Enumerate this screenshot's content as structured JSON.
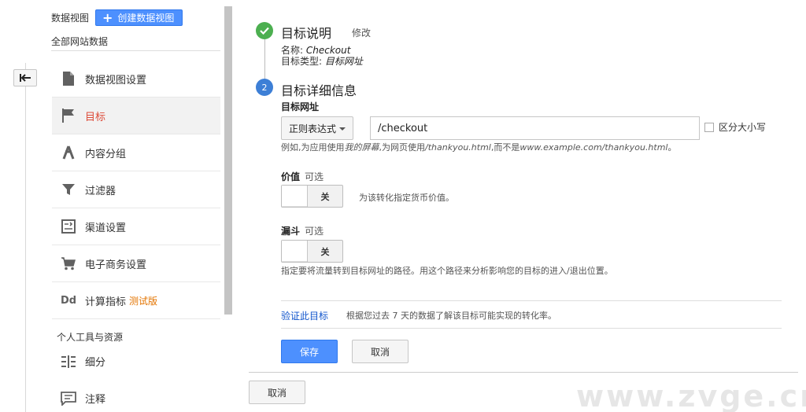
{
  "sidebar": {
    "view_label": "数据视图",
    "create_view_label": "创建数据视图",
    "site_data": "全部网站数据",
    "items": [
      {
        "label": "数据视图设置",
        "icon": "document-icon"
      },
      {
        "label": "目标",
        "icon": "flag-icon",
        "active": true
      },
      {
        "label": "内容分组",
        "icon": "content-grouping-icon"
      },
      {
        "label": "过滤器",
        "icon": "filter-icon"
      },
      {
        "label": "渠道设置",
        "icon": "channel-settings-icon"
      },
      {
        "label": "电子商务设置",
        "icon": "cart-icon"
      },
      {
        "label": "计算指标",
        "icon": "dd-icon",
        "badge": "测试版"
      }
    ],
    "tools_title": "个人工具与资源",
    "tools_items": [
      {
        "label": "细分",
        "icon": "segments-icon"
      },
      {
        "label": "注释",
        "icon": "annotation-icon"
      }
    ]
  },
  "goal_description": {
    "title": "目标说明",
    "edit_label": "修改",
    "name_label": "名称:",
    "name_value": "Checkout",
    "type_label": "目标类型:",
    "type_value": "目标网址"
  },
  "goal_details": {
    "step_number": "2",
    "title": "目标详细信息",
    "destination_label": "目标网址",
    "match_type": "正则表达式",
    "destination_value": "/checkout",
    "case_sensitive_label": "区分大小写",
    "example_prefix": "例如,为应用使用",
    "example_app": "我的屏幕",
    "example_mid": ",为网页使用",
    "example_page": "/thankyou.html",
    "example_mid2": ",而不是",
    "example_full": "www.example.com/thankyou.html",
    "example_suffix": "。",
    "value_label": "价值",
    "value_optional": "可选",
    "value_toggle": "关",
    "value_hint": "为该转化指定货币价值。",
    "funnel_label": "漏斗",
    "funnel_optional": "可选",
    "funnel_toggle": "关",
    "funnel_hint": "指定要将流量转到目标网址的路径。用这个路径来分析影响您的目标的进入/退出位置。",
    "verify_label": "验证此目标",
    "verify_desc": "根据您过去 7 天的数据了解该目标可能实现的转化率。",
    "save_label": "保存",
    "cancel_label": "取消"
  },
  "footer": {
    "cancel_label": "取消"
  },
  "watermark": "www.zvge.cn",
  "colors": {
    "primary_blue": "#4d90fe",
    "active_red": "#dd4b39",
    "beta_orange": "#e37400",
    "check_green": "#4caf50",
    "link_blue": "#1155cc"
  }
}
